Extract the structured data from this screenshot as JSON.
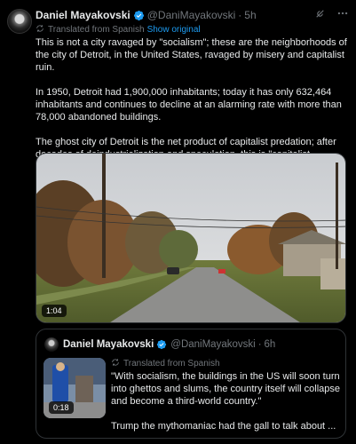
{
  "author": {
    "name": "Daniel Mayakovski",
    "handle": "@DaniMayakovski",
    "separator": "·",
    "time": "5h"
  },
  "translation": {
    "note": "Translated from Spanish",
    "show_original": "Show original"
  },
  "body": {
    "p1": "This is not a city ravaged by \"socialism\"; these are the neighborhoods of the city of Detroit, in the United States, ravaged by misery and capitalist ruin.",
    "p2": "In 1950, Detroit had 1,900,000 inhabitants; today it has only 632,464 inhabitants and continues to decline at an alarming rate with more than 78,000 abandoned buildings.",
    "p3": "The ghost city of Detroit is the net product of capitalist predation; after decades of deindustrialization and speculation, this is \"capitalist progress.\""
  },
  "media": {
    "duration": "1:04"
  },
  "quote": {
    "name": "Daniel Mayakovski",
    "handle": "@DaniMayakovski",
    "separator": "·",
    "time": "6h",
    "translated": "Translated from Spanish",
    "thumb_duration": "0:18",
    "p1": "\"With socialism, the buildings in the US will soon turn into ghettos and slums, the country itself will collapse and become a third-world country.\"",
    "p2": "Trump the mythomaniac had the gall to talk about ..."
  },
  "colors": {
    "background": "#000000",
    "text": "#e7e9ea",
    "secondary": "#71767b",
    "link": "#1d9bf0",
    "verified": "#1d9bf0",
    "border": "#2f3336"
  },
  "icons": [
    "verified-badge-icon",
    "grok-icon",
    "more-icon",
    "translate-icon"
  ]
}
